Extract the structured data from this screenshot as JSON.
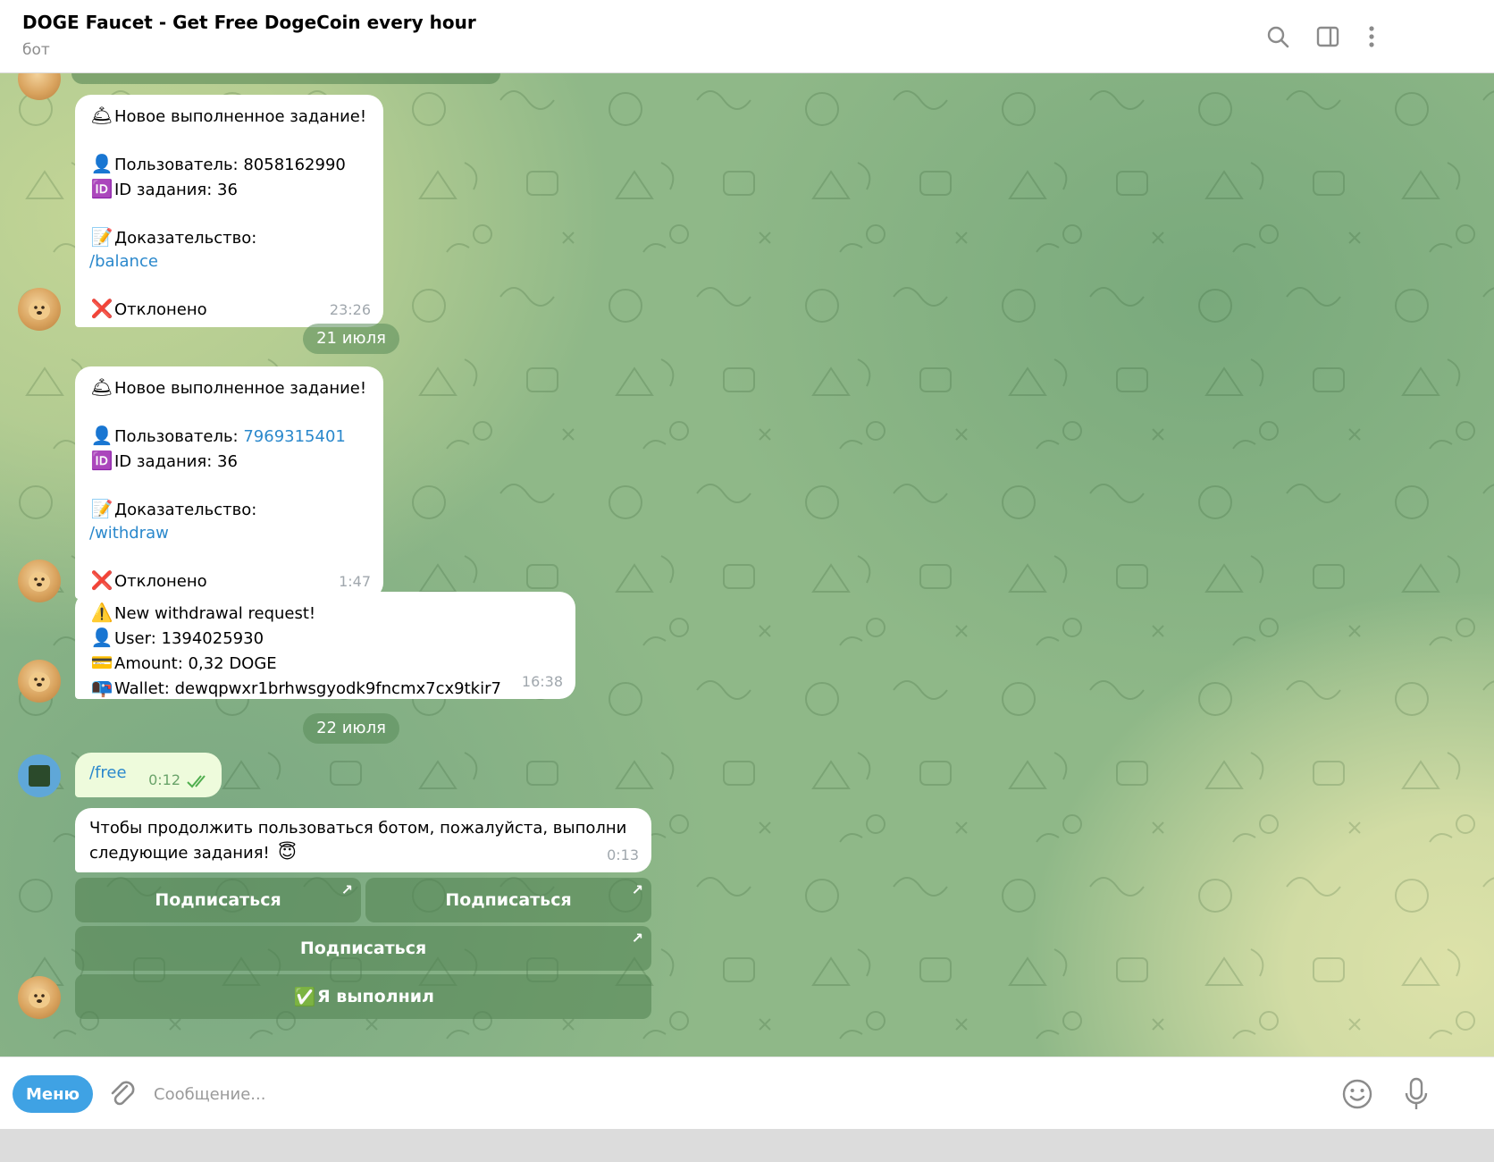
{
  "header": {
    "title": "DOGE Faucet - Get Free DogeCoin every hour",
    "subtitle": "бот"
  },
  "messages": {
    "task1": {
      "title": "Новое выполненное задание!",
      "user_label": "Пользователь: ",
      "user_id": "8058162990",
      "task_id": "ID задания: 36",
      "proof_label": "Доказательство:",
      "proof_cmd": "/balance",
      "status": "Отклонено",
      "time": "23:26"
    },
    "date1": "21 июля",
    "task2": {
      "title": "Новое выполненное задание!",
      "user_label": "Пользователь: ",
      "user_id": "7969315401",
      "task_id": "ID задания: 36",
      "proof_label": "Доказательство:",
      "proof_cmd": "/withdraw",
      "status": "Отклонено",
      "time": "1:47"
    },
    "withdrawal": {
      "title": "New withdrawal request!",
      "user": "User: 1394025930",
      "amount": "Amount: 0,32 DOGE",
      "wallet": "Wallet: dewqpwxr1brhwsgyodk9fncmx7cx9tkir7",
      "time": "16:38"
    },
    "date2": "22 июля",
    "outgoing": {
      "text": "/free",
      "time": "0:12"
    },
    "subscribe": {
      "line1": "Чтобы продолжить пользоваться ботом, пожалуйста, выполни",
      "line2": "следующие задания! ",
      "time": "0:13"
    }
  },
  "buttons": {
    "subscribe1": "Подписаться",
    "subscribe2": "Подписаться",
    "subscribe3": "Подписаться",
    "done": "Я выполнил"
  },
  "composer": {
    "menu_label": "Меню",
    "placeholder": "Сообщение..."
  },
  "icons": {
    "bell": "🛎",
    "user": "👤",
    "id": "🆔",
    "memo": "📝",
    "cross": "❌",
    "warning": "⚠️",
    "card": "💳",
    "mailbox": "📭",
    "halo": "😇",
    "check": "✅"
  },
  "colors": {
    "link": "#2a88cc",
    "menu_button": "#3fa2e4",
    "read_ticks": "#4fae4e"
  }
}
